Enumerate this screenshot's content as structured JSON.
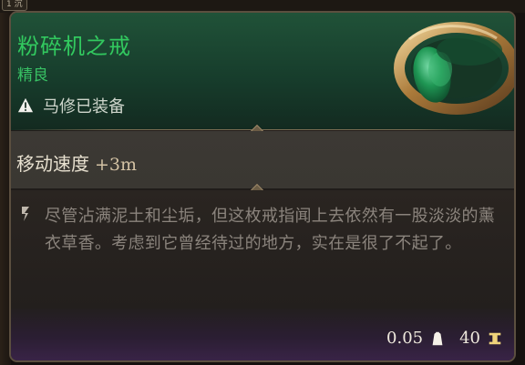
{
  "top_tab": "1 沉",
  "item": {
    "name": "粉碎机之戒",
    "rarity": "精良",
    "equipped_text": "马修已装备",
    "stat_label": "移动速度",
    "stat_value": "+3m",
    "description": "尽管沾满泥土和尘垢，但这枚戒指闻上去依然有一股淡淡的薰衣草香。考虑到它曾经待过的地方，实在是很了不起了。",
    "weight": "0.05",
    "value": "40"
  },
  "colors": {
    "title": "#32c95f",
    "rarity": "#38c164",
    "stat_value": "#d3c2a4",
    "description": "#8b847d"
  },
  "icons": {
    "warning": "warning-icon",
    "quote": "quote-icon",
    "weight": "weight-icon",
    "gold": "gold-icon"
  }
}
